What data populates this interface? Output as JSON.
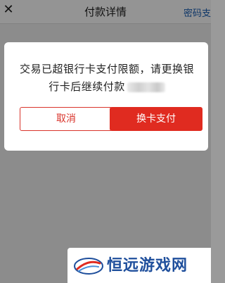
{
  "nav": {
    "close_icon": "close-icon",
    "title": "付款详情",
    "right_link": "密码支"
  },
  "dialog": {
    "message": "交易已超银行卡支付限额，请更换银行卡后继续付款",
    "cancel_label": "取消",
    "switch_card_label": "换卡支付"
  },
  "watermark": {
    "text": "恒远游戏网"
  },
  "colors": {
    "accent_red": "#e02b20",
    "link_blue": "#1a5fb4",
    "watermark_blue": "#1f4f9c"
  }
}
